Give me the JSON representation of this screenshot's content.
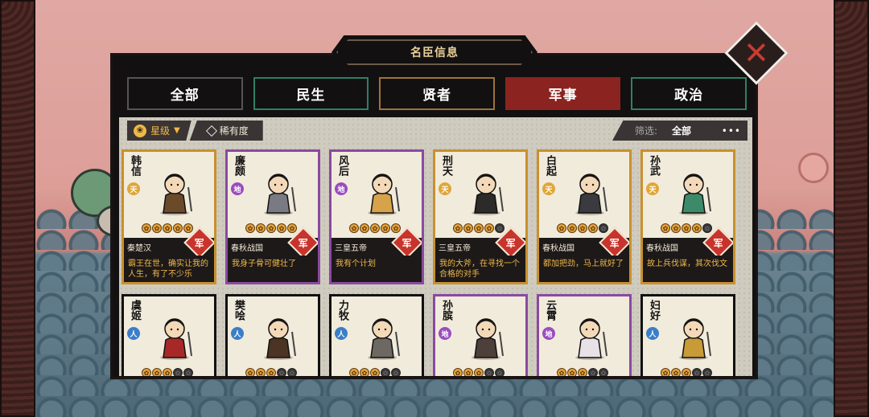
{
  "header": {
    "title": "名臣信息"
  },
  "tabs": [
    {
      "label": "全部"
    },
    {
      "label": "民生"
    },
    {
      "label": "贤者"
    },
    {
      "label": "军事"
    },
    {
      "label": "政治"
    }
  ],
  "active_tab": "军事",
  "filters": {
    "star_label": "星级",
    "rarity_label": "稀有度",
    "filter_label": "筛选:",
    "filter_value": "全部",
    "more": "•••"
  },
  "cards": [
    {
      "name": "韩信",
      "rank": "天",
      "stars": 5,
      "era": "秦楚汉",
      "type": "军",
      "quote": "霸王在世，确实让我的人生，有了不少乐"
    },
    {
      "name": "廉颇",
      "rank": "地",
      "stars": 5,
      "era": "春秋战国",
      "type": "军",
      "quote": "我身子骨可健壮了"
    },
    {
      "name": "风后",
      "rank": "地",
      "stars": 5,
      "era": "三皇五帝",
      "type": "军",
      "quote": "我有个计划"
    },
    {
      "name": "刑天",
      "rank": "天",
      "stars": 4,
      "era": "三皇五帝",
      "type": "军",
      "quote": "我的大斧，在寻找一个合格的对手"
    },
    {
      "name": "白起",
      "rank": "天",
      "stars": 4,
      "era": "春秋战国",
      "type": "军",
      "quote": "都加把劲，马上就好了"
    },
    {
      "name": "孙武",
      "rank": "天",
      "stars": 4,
      "era": "春秋战国",
      "type": "军",
      "quote": "故上兵伐谋，其次伐文"
    },
    {
      "name": "虞姬",
      "rank": "人",
      "stars": 3
    },
    {
      "name": "樊哙",
      "rank": "人",
      "stars": 3
    },
    {
      "name": "力牧",
      "rank": "人",
      "stars": 3
    },
    {
      "name": "孙膑",
      "rank": "地",
      "stars": 3
    },
    {
      "name": "云霄",
      "rank": "地",
      "stars": 3
    },
    {
      "name": "妇好",
      "rank": "人",
      "stars": 3
    }
  ]
}
